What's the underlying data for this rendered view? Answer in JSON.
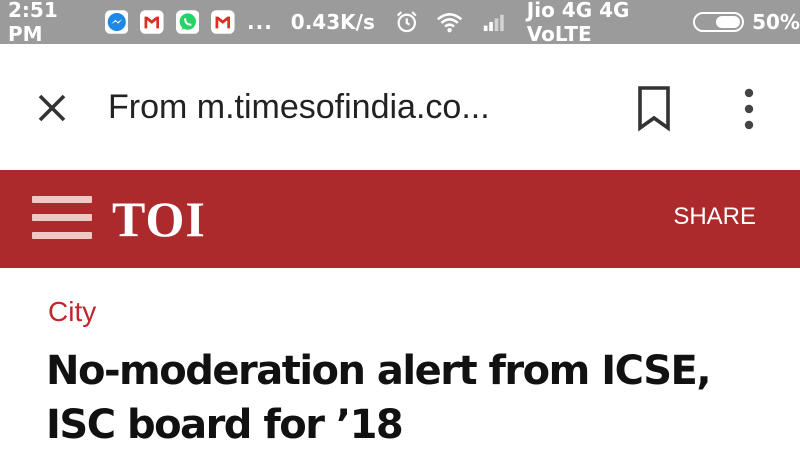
{
  "status_bar": {
    "time": "2:51 PM",
    "notifications": [
      "messenger-icon",
      "gmail-icon",
      "whatsapp-icon",
      "gmail-icon"
    ],
    "more": "...",
    "speed": "0.43K/s",
    "carrier": "Jio 4G 4G VoLTE",
    "battery_percent": "50%",
    "battery_level": 0.5
  },
  "toolbar": {
    "url": "From m.timesofindia.co...",
    "close_icon": "close-icon",
    "bookmark_icon": "bookmark-icon",
    "menu_icon": "more-vert-icon"
  },
  "site_header": {
    "logo": "TOI",
    "share_label": "SHARE",
    "background": "#ad2a2c"
  },
  "article": {
    "category": "City",
    "headline": "No-moderation alert from ICSE, ISC board for ’18"
  }
}
